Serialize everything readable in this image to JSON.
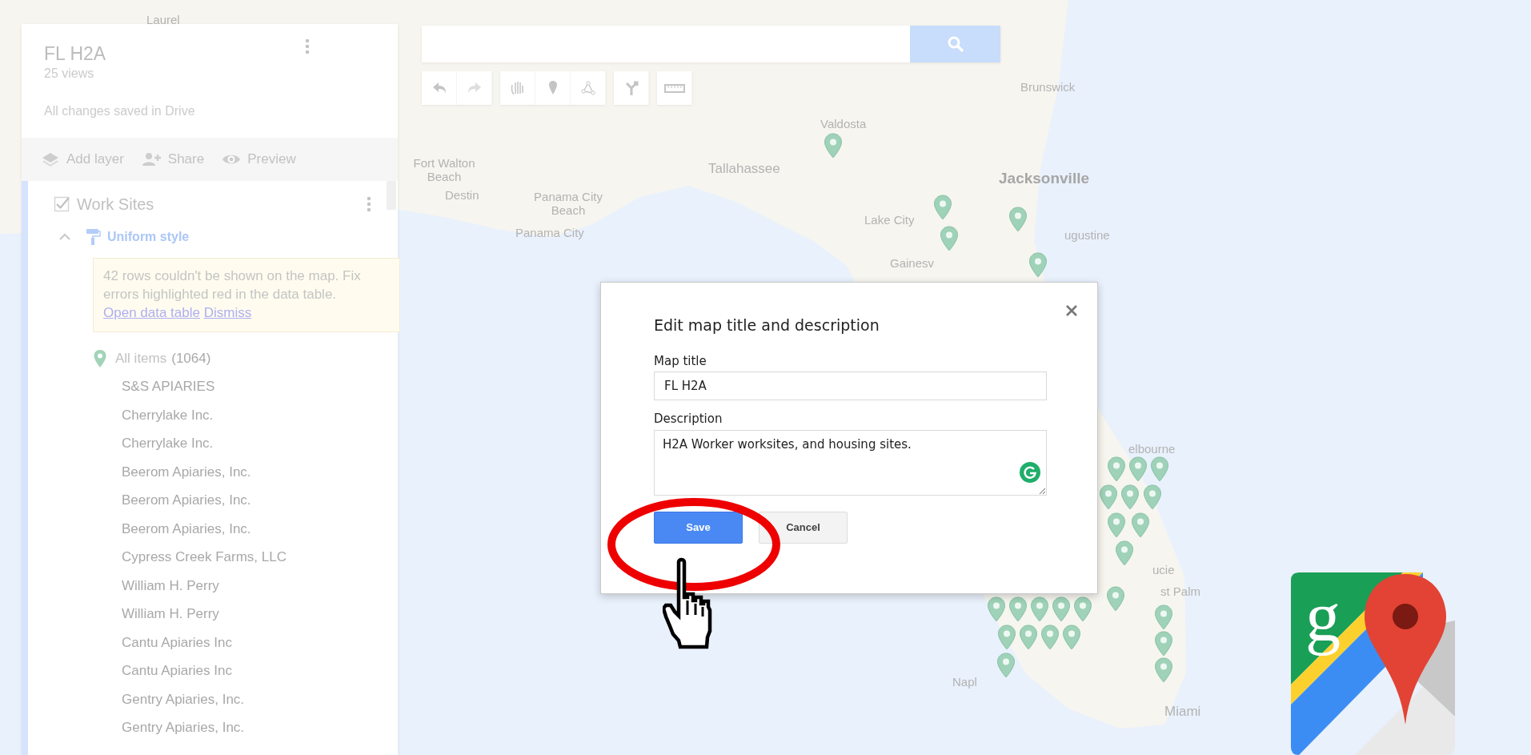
{
  "map": {
    "labels": [
      {
        "text": "Laurel",
        "kind": "town"
      },
      {
        "text": "Brunswick",
        "kind": "town"
      },
      {
        "text": "Valdosta",
        "kind": "town"
      },
      {
        "text": "Fort Walton Beach",
        "kind": "town"
      },
      {
        "text": "Destin",
        "kind": "town"
      },
      {
        "text": "Tallahassee",
        "kind": "city"
      },
      {
        "text": "Jacksonville",
        "kind": "major"
      },
      {
        "text": "Panama City Beach",
        "kind": "town"
      },
      {
        "text": "Panama City",
        "kind": "town"
      },
      {
        "text": "Lake City",
        "kind": "town"
      },
      {
        "text": "ugustine",
        "kind": "town"
      },
      {
        "text": "Gainesv",
        "kind": "town"
      },
      {
        "text": "elbourne",
        "kind": "town"
      },
      {
        "text": "ucie",
        "kind": "town"
      },
      {
        "text": "st Palm",
        "kind": "town"
      },
      {
        "text": "Napl",
        "kind": "town"
      },
      {
        "text": "Miami",
        "kind": "city"
      }
    ]
  },
  "sidebar": {
    "title": "FL H2A",
    "views": "25 views",
    "save_status": "All changes saved in Drive",
    "actions": [
      {
        "label": "Add layer",
        "kind": "layers"
      },
      {
        "label": "Share",
        "kind": "share"
      },
      {
        "label": "Preview",
        "kind": "preview"
      }
    ],
    "layer": {
      "name": "Work Sites",
      "checked": true,
      "expanded": true,
      "style": "Uniform style",
      "warning": {
        "text": "42 rows couldn't be shown on the map. Fix errors highlighted red in the data table.",
        "links": [
          "Open data table",
          "Dismiss"
        ]
      },
      "all_items": {
        "label": "All items",
        "count": "(1064)"
      },
      "items": [
        "S&S APIARIES",
        "Cherrylake Inc.",
        "Cherrylake Inc.",
        "Beerom Apiaries, Inc.",
        "Beerom Apiaries, Inc.",
        "Beerom Apiaries, Inc.",
        "Cypress Creek Farms, LLC",
        "William H. Perry",
        "William H. Perry",
        "Cantu Apiaries Inc",
        "Cantu Apiaries Inc",
        "Gentry Apiaries, Inc.",
        "Gentry Apiaries, Inc."
      ]
    }
  },
  "dialog": {
    "title": "Edit map title and description",
    "fields": [
      {
        "label": "Map title",
        "value": "FL H2A",
        "kind": "input"
      },
      {
        "label": "Description",
        "value": "H2A Worker worksites, and housing sites.",
        "kind": "textarea"
      }
    ],
    "buttons": [
      {
        "label": "Save",
        "primary": true
      },
      {
        "label": "Cancel",
        "primary": false
      }
    ]
  },
  "logo": {
    "letter": "g"
  }
}
